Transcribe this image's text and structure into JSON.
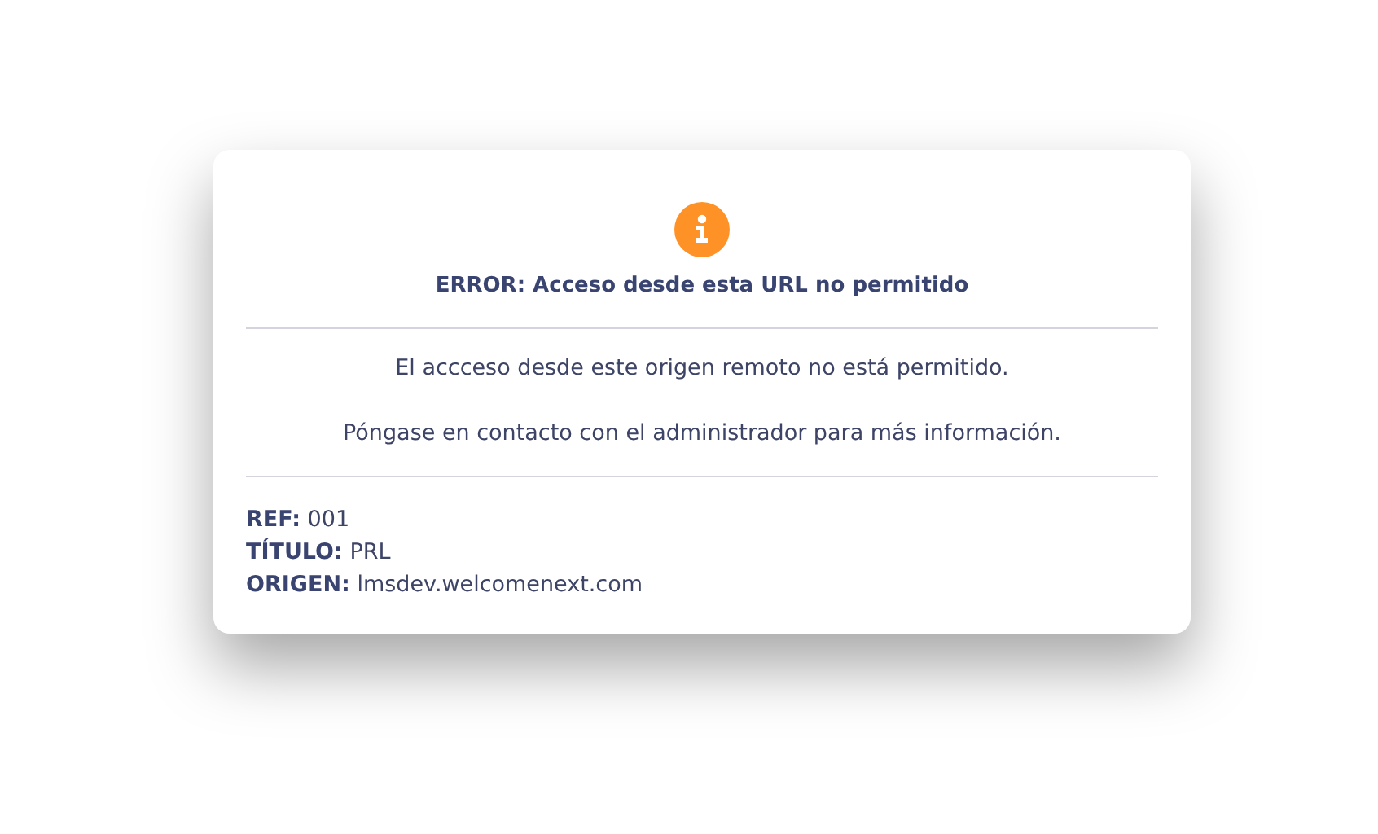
{
  "dialog": {
    "title": "ERROR: Acceso desde esta URL no permitido",
    "messages": [
      "El accceso desde este origen remoto no está permitido.",
      "Póngase en contacto con el administrador para más información."
    ],
    "details": [
      {
        "label": "REF:",
        "value": "001"
      },
      {
        "label": "TÍTULO:",
        "value": "PRL"
      },
      {
        "label": "ORIGEN:",
        "value": "lmsdev.welcomenext.com"
      }
    ]
  }
}
